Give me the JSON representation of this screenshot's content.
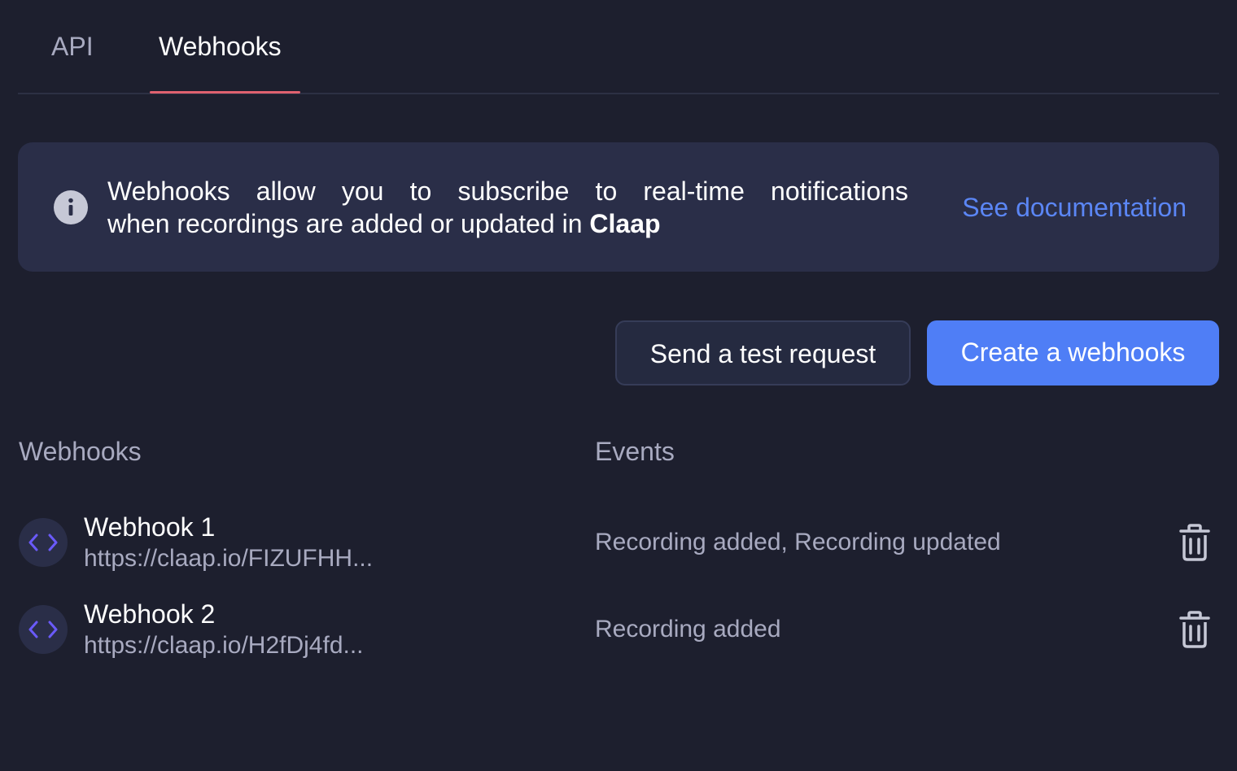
{
  "tabs": [
    {
      "label": "API",
      "active": false
    },
    {
      "label": "Webhooks",
      "active": true
    }
  ],
  "banner": {
    "line1_words": [
      "Webhooks",
      "allow",
      "you",
      "to",
      "subscribe",
      "to",
      "real-time",
      "notifications"
    ],
    "line2_prefix": "when recordings are added or updated in ",
    "line2_bold": "Claap",
    "link_label": "See documentation",
    "icon": "info-icon"
  },
  "actions": {
    "test_label": "Send a test request",
    "create_label": "Create a webhooks"
  },
  "table": {
    "col_webhooks": "Webhooks",
    "col_events": "Events",
    "rows": [
      {
        "name": "Webhook 1",
        "url": "https://claap.io/FIZUFHH...",
        "events": "Recording added, Recording updated",
        "icon": "code-icon",
        "delete_icon": "trash-icon"
      },
      {
        "name": "Webhook 2",
        "url": "https://claap.io/H2fDj4fd...",
        "events": "Recording added",
        "icon": "code-icon",
        "delete_icon": "trash-icon"
      }
    ]
  },
  "colors": {
    "background": "#1d1f2e",
    "banner": "#2a2e48",
    "accent": "#4f7ef6",
    "link": "#5b86f5",
    "tab_indicator": "#e0616f",
    "code_icon": "#6a5af9"
  }
}
